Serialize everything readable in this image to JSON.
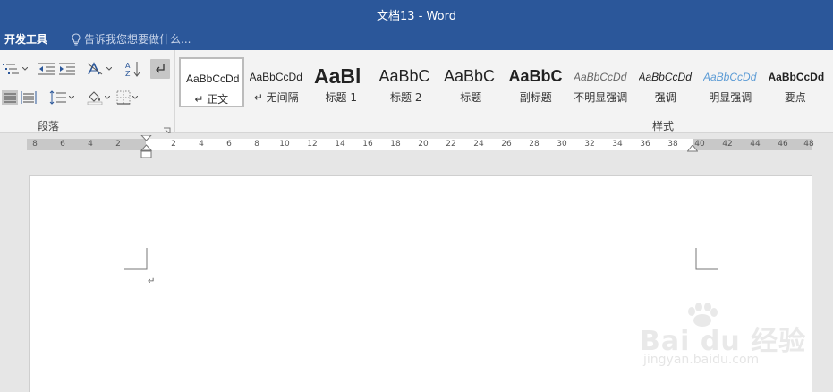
{
  "window": {
    "title": "文档13 - Word"
  },
  "tabs": {
    "active_tab": "开发工具",
    "tell_me": "告诉我您想要做什么..."
  },
  "ribbon": {
    "paragraph_group": {
      "label": "段落"
    },
    "styles_group": {
      "label": "样式",
      "items": [
        {
          "sample": "AaBbCcDd",
          "name": "↵ 正文",
          "selected": true
        },
        {
          "sample": "AaBbCcDd",
          "name": "↵ 无间隔"
        },
        {
          "sample": "AaBl",
          "name": "标题 1"
        },
        {
          "sample": "AaBbC",
          "name": "标题 2"
        },
        {
          "sample": "AaBbC",
          "name": "标题"
        },
        {
          "sample": "AaBbC",
          "name": "副标题"
        },
        {
          "sample": "AaBbCcDd",
          "name": "不明显强调"
        },
        {
          "sample": "AaBbCcDd",
          "name": "强调"
        },
        {
          "sample": "AaBbCcDd",
          "name": "明显强调"
        },
        {
          "sample": "AaBbCcDd",
          "name": "要点"
        }
      ]
    }
  },
  "ruler": {
    "labels": [
      "8",
      "6",
      "4",
      "2",
      "2",
      "4",
      "6",
      "8",
      "10",
      "12",
      "14",
      "16",
      "18",
      "20",
      "22",
      "24",
      "26",
      "28",
      "30",
      "32",
      "34",
      "36",
      "38",
      "40",
      "42",
      "44",
      "46",
      "48"
    ]
  },
  "document": {
    "paragraph_mark": "↵"
  },
  "watermark": {
    "main": "Bai du 经验",
    "sub": "jingyan.baidu.com"
  },
  "colors": {
    "accent": "#2b579a",
    "ribbon_bg": "#f3f3f3",
    "page": "#ffffff"
  }
}
